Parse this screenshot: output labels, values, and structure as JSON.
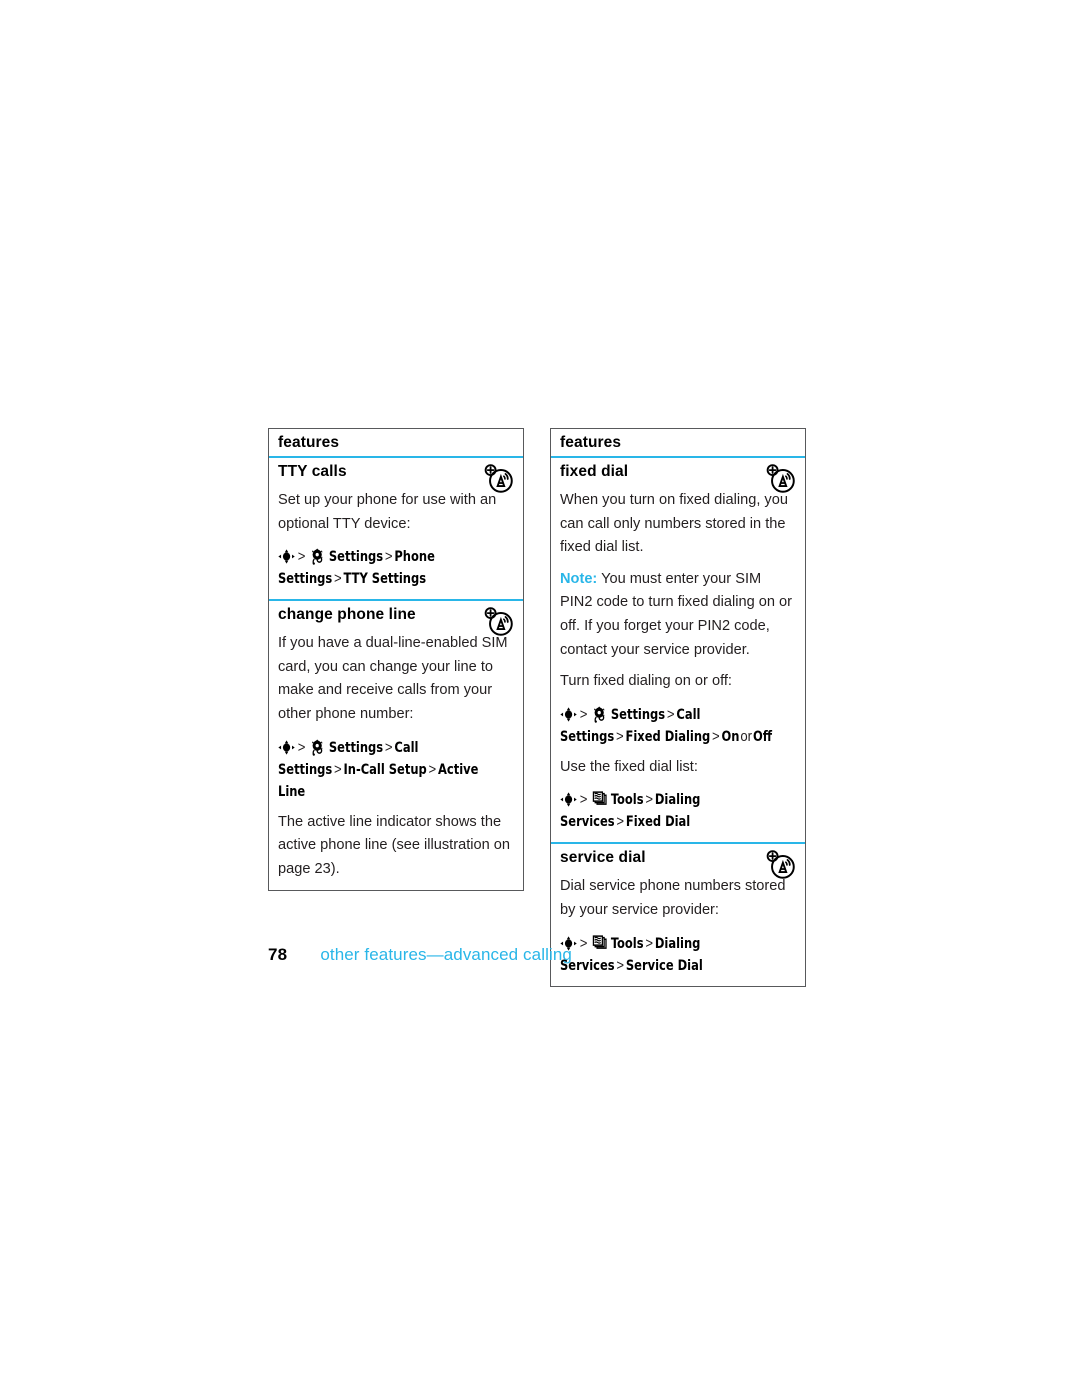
{
  "page": {
    "number": "78",
    "breadcrumb": "other features—advanced calling"
  },
  "colors": {
    "accent": "#29b6e8",
    "text": "#231f20",
    "border": "#58595b"
  },
  "icons": {
    "navigation_key": "navigation-key-icon",
    "settings": "settings-gear-icon",
    "tools": "tools-icon",
    "accessibility": "tty-accessibility-icon"
  },
  "tables": [
    {
      "header": "features",
      "rows": [
        {
          "title": "TTY calls",
          "has_access_icon": true,
          "blocks": [
            {
              "type": "para",
              "text": "Set up your phone for use with an optional TTY device:"
            },
            {
              "type": "path",
              "icon": "settings",
              "items": [
                "Settings",
                "Phone Settings",
                "TTY Settings"
              ]
            }
          ]
        },
        {
          "title": "change phone line",
          "has_access_icon": true,
          "blocks": [
            {
              "type": "para",
              "text": "If you have a dual-line-enabled SIM card, you can change your line to make and receive calls from your other phone number:"
            },
            {
              "type": "path",
              "icon": "settings",
              "items": [
                "Settings",
                "Call Settings",
                "In-Call Setup",
                "Active Line"
              ]
            },
            {
              "type": "para",
              "text": "The active line indicator shows the active phone line (see illustration on page 23)."
            }
          ]
        }
      ]
    },
    {
      "header": "features",
      "rows": [
        {
          "title": "fixed dial",
          "has_access_icon": true,
          "blocks": [
            {
              "type": "para",
              "text": "When you turn on fixed dialing, you can call only numbers stored in the fixed dial list."
            },
            {
              "type": "note",
              "label": "Note:",
              "text": " You must enter your SIM PIN2 code to turn fixed dialing on or off. If you forget your PIN2 code, contact your service provider."
            },
            {
              "type": "para",
              "text": "Turn fixed dialing on or off:"
            },
            {
              "type": "path",
              "icon": "settings",
              "items": [
                "Settings",
                "Call Settings",
                "Fixed Dialing"
              ],
              "tail": {
                "pre": "On",
                "plain": "or",
                "post": "Off"
              }
            },
            {
              "type": "para",
              "text": "Use the fixed dial list:"
            },
            {
              "type": "path",
              "icon": "tools",
              "items": [
                "Tools",
                "Dialing Services",
                "Fixed Dial"
              ]
            }
          ]
        },
        {
          "title": "service dial",
          "has_access_icon": true,
          "blocks": [
            {
              "type": "para",
              "text": "Dial service phone numbers stored by your service provider:"
            },
            {
              "type": "path",
              "icon": "tools",
              "items": [
                "Tools",
                "Dialing Services",
                "Service Dial"
              ]
            }
          ]
        }
      ]
    }
  ]
}
